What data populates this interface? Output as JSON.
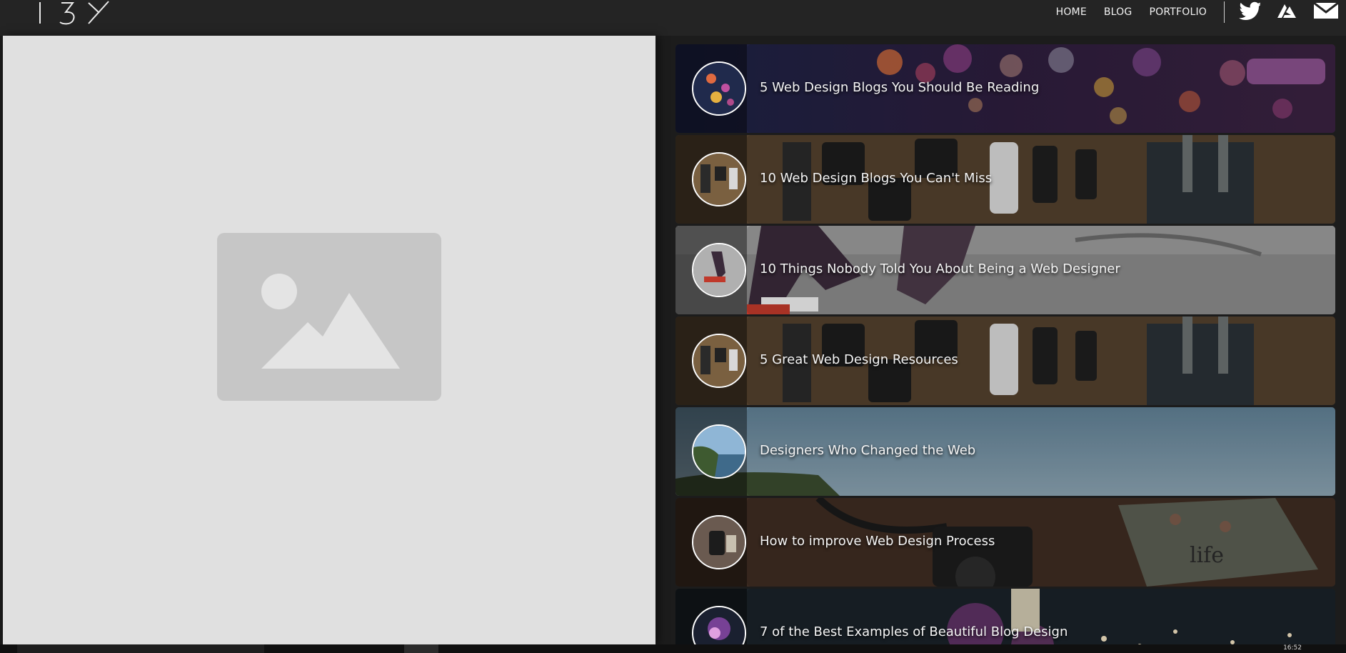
{
  "header": {
    "nav": [
      {
        "label": "HOME"
      },
      {
        "label": "BLOG"
      },
      {
        "label": "PORTFOLIO"
      }
    ],
    "social_icons": [
      "twitter-icon",
      "behance-icon",
      "mail-icon"
    ]
  },
  "main": {
    "image_placeholder_icon": "image-placeholder-icon"
  },
  "posts": [
    {
      "title": "5 Web Design Blogs You Should Be Reading",
      "theme": "bokeh"
    },
    {
      "title": "10 Web Design Blogs You Can't Miss",
      "theme": "cameras"
    },
    {
      "title": "10 Things Nobody Told You About Being a Web Designer",
      "theme": "skate"
    },
    {
      "title": "5 Great Web Design Resources",
      "theme": "cameras"
    },
    {
      "title": "Designers Who Changed the Web",
      "theme": "coast"
    },
    {
      "title": "How to improve Web Design Process",
      "theme": "desk"
    },
    {
      "title": "7 of the Best Examples of Beautiful Blog Design",
      "theme": "stage"
    }
  ],
  "taskbar": {
    "clock": "16:52"
  },
  "colors": {
    "header_bg": "#242424",
    "page_bg": "#1c1c1c",
    "left_panel_bg": "#e0e0e0",
    "placeholder_bg": "#c6c6c6",
    "text_light": "#f4f4f4"
  }
}
